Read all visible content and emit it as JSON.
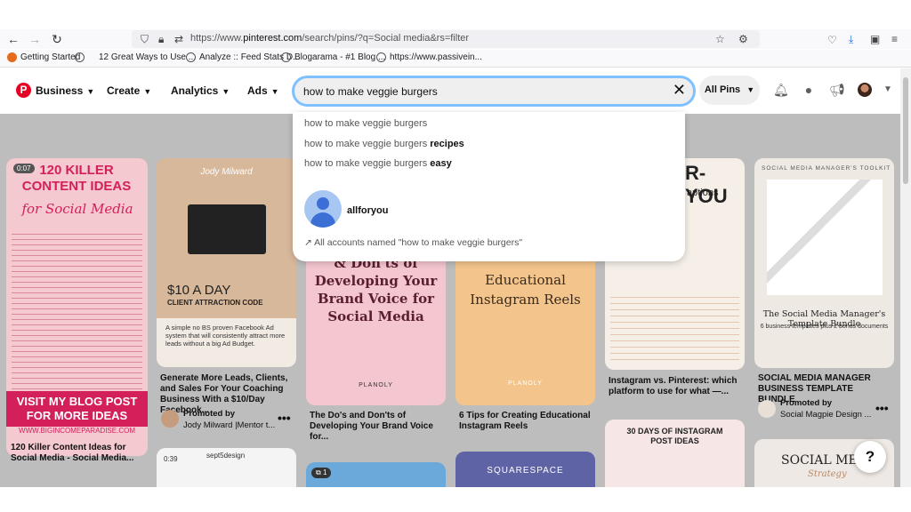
{
  "browser": {
    "url_prefix": "https://www.",
    "url_domain": "pinterest.com",
    "url_rest": "/search/pins/?q=Social media&rs=filter",
    "icons": [
      "back-icon",
      "forward-icon",
      "reload-icon",
      "shield-icon",
      "lock-icon",
      "permissions-icon",
      "star-icon",
      "extension-icon",
      "pocket-icon",
      "download-icon",
      "sidebar-icon",
      "menu-icon"
    ]
  },
  "bookmarks": [
    {
      "label": "Getting Started",
      "icon": "firefox-icon"
    },
    {
      "label": "12 Great Ways to Use ...",
      "icon": "globe-icon"
    },
    {
      "label": "Analyze :: Feed Stats D...",
      "icon": "globe-icon"
    },
    {
      "label": "Blogarama - #1 Blog ...",
      "icon": "globe-icon"
    },
    {
      "label": "https://www.passivein...",
      "icon": "globe-icon"
    }
  ],
  "header": {
    "menu": [
      {
        "label": "Business"
      },
      {
        "label": "Create"
      },
      {
        "label": "Analytics"
      },
      {
        "label": "Ads"
      }
    ],
    "search_value": "how to make veggie burgers",
    "scope": "All Pins",
    "icons": [
      "bell-icon",
      "chat-icon",
      "megaphone-icon",
      "avatar",
      "chevron-down-icon"
    ]
  },
  "dropdown": {
    "suggestions": [
      {
        "base": "how to make veggie burgers",
        "bold": ""
      },
      {
        "base": "how to make veggie burgers ",
        "bold": "recipes"
      },
      {
        "base": "how to make veggie burgers ",
        "bold": "easy"
      }
    ],
    "account_name": "allforyou",
    "all_accounts": "All accounts named \"how to make veggie burgers\""
  },
  "pins": [
    {
      "id": "p1",
      "title": "120 Killer Content Ideas for Social Media - Social Media...",
      "img_text_top": "120 KILLER CONTENT IDEAS",
      "img_text_script": "for Social Media",
      "img_text_bottom": "VISIT MY BLOG POST FOR MORE IDEAS",
      "img_url": "WWW.BIGINCOMEPARADISE.COM",
      "badge": "0:07",
      "bg": "#f4c9cf"
    },
    {
      "id": "p2",
      "title": "Generate More Leads, Clients, and Sales For Your Coaching Business With a $10/Day Facebook...",
      "img_name": "Jody Milward",
      "img_price": "$10 A DAY",
      "img_sub": "CLIENT ATTRACTION CODE",
      "img_desc": "A simple no BS proven Facebook Ad system that will consistently attract more leads without a big Ad Budget.",
      "promoted_by": "Promoted by",
      "promoter": "Jody Milward |Mentor t...",
      "bg": "#d8b89a"
    },
    {
      "id": "p3",
      "title": "The Do's and Don'ts of Developing Your Brand Voice for...",
      "img_text": "& Don'ts of Developing Your Brand Voice for Social Media",
      "img_brand": "PLANOLY",
      "bg": "#f4c6cf"
    },
    {
      "id": "p4",
      "title": "6 Tips for Creating Educational Instagram Reels",
      "img_text": "Educational Instagram Reels",
      "img_brand": "PLANOLY",
      "bg": "#f3c58c"
    },
    {
      "id": "p5",
      "title": "Instagram vs. Pinterest: which platform to use for what —...",
      "img_text": "R-YOU",
      "img_sub": "aptions",
      "bg": "#f5efe8"
    },
    {
      "id": "p6",
      "title": "SOCIAL MEDIA MANAGER BUSINESS TEMPLATE BUNDLE",
      "img_heading": "SOCIAL MEDIA MANAGER'S TOOLKIT",
      "img_text": "The Social Media Manager's Template Bundle",
      "img_sub": "6 business templates plus 2 bonus documents",
      "promoted_by": "Promoted by",
      "promoter": "Social Magpie Design ...",
      "bg": "#efe9e3"
    },
    {
      "id": "p7",
      "img_text": "30 DAYS OF INSTAGRAM POST IDEAS",
      "bg": "#f7e6e6"
    },
    {
      "id": "p8",
      "img_text": "SOCIAL MEDIA",
      "img_script": "Strategy",
      "bg": "#eee9e4"
    },
    {
      "id": "p9",
      "img_brand": "SQUARESPACE",
      "bg": "#5e63a6"
    },
    {
      "id": "p10",
      "badge": "1",
      "bg": "#6aa9d9"
    },
    {
      "id": "p11",
      "badge": "0:39",
      "user": "sept5design",
      "bg": "#f4f4f4"
    }
  ],
  "help_label": "?"
}
